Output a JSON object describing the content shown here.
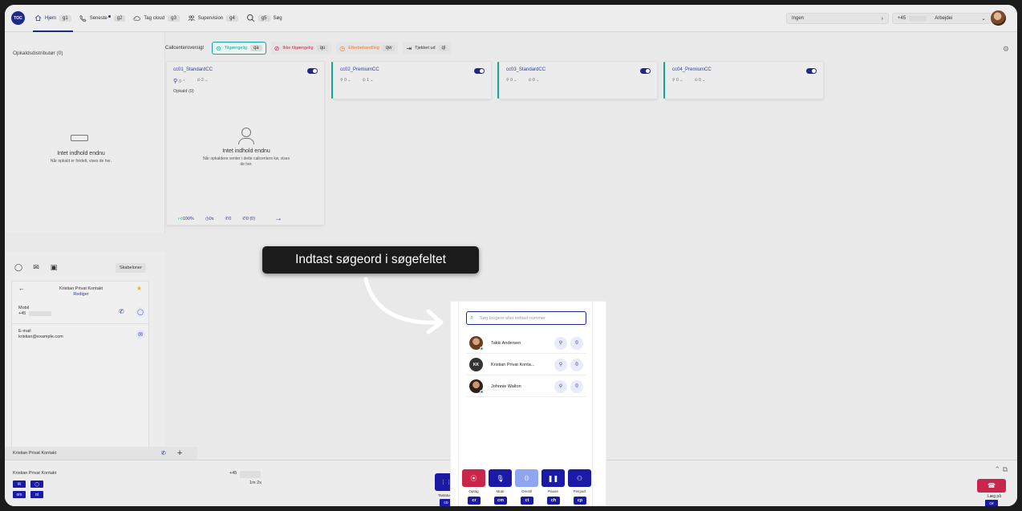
{
  "nav": {
    "logo": "TOC",
    "items": [
      {
        "label": "Hjem",
        "key": "g1"
      },
      {
        "label": "Seneste",
        "key": "g2"
      },
      {
        "label": "Tag cloud",
        "key": "g3"
      },
      {
        "label": "Supervision",
        "key": "g4"
      },
      {
        "label": "Søg",
        "key": "g5"
      }
    ],
    "queue_select": "Ingen",
    "phone_prefix": "+45",
    "status_select": "Arbejdei"
  },
  "left_panel": {
    "title": "Opkaldsdistributør (0)",
    "empty_title": "Intet indhold endnu",
    "empty_sub": "Når opkald er fordelt, vises de her."
  },
  "statusbar": {
    "label": "Callcenteroversigt",
    "available": {
      "label": "Tilgængelig",
      "key": "qa"
    },
    "unavailable": {
      "label": "Ikke tilgængelig",
      "key": "qu"
    },
    "wrapup": {
      "label": "Efterbehandling",
      "key": "qw"
    },
    "checkedout": {
      "label": "Tjekket ud",
      "key": "ql"
    }
  },
  "cards": [
    {
      "name": "cc01_StandardCC",
      "agents": "0",
      "waiting": "2",
      "calls_label": "Opkald (0)"
    },
    {
      "name": "cc02_PremiumCC",
      "agents": "0",
      "waiting": "1"
    },
    {
      "name": "cc03_StandardCC",
      "agents": "0",
      "waiting": "0"
    },
    {
      "name": "cc04_PremiumCC",
      "agents": "0",
      "waiting": "0"
    }
  ],
  "card1": {
    "empty_title": "Intet indhold endnu",
    "empty_sub": "Når opkaldere venter i dette callcenters kø, vises de her.",
    "footer": {
      "rate": "100%",
      "time": "0s",
      "calls": "0",
      "missed": "0 (0)"
    }
  },
  "chat_panel": {
    "templates_button": "Skabeloner",
    "contact_name": "Kristian Privat Kontakt",
    "edit_link": "Rediger",
    "mobile_label": "Mobil",
    "mobile_value": "+45",
    "email_label": "E-mail",
    "email_value": "kristian@example.com",
    "tab_label": "Kristian Privat Kontakt"
  },
  "bottom": {
    "caller": "Kristian Privat Kontakt",
    "number": "+45",
    "duration": "1m 2s",
    "keys": [
      "om",
      "ot"
    ],
    "hangup_label": "Læg på",
    "hangup_key": "ce",
    "keypad_label": "Tastatur",
    "keypad_key": "co"
  },
  "tooltip": "Indtast søgeord i søgefeltet",
  "popup": {
    "search_placeholder": "Søg brugere eller indtast nummer",
    "results": [
      {
        "name": "Takki Andersen"
      },
      {
        "name": "Kristian Privat Konta...",
        "initials": "KK"
      },
      {
        "name": "Johnnie Walton"
      }
    ]
  },
  "controls": [
    {
      "label": "Optag",
      "key": "cr"
    },
    {
      "label": "Mute",
      "key": "cm"
    },
    {
      "label": "Omstil",
      "key": "ct"
    },
    {
      "label": "Pause",
      "key": "ch"
    },
    {
      "label": "Flerpart",
      "key": "cp"
    }
  ],
  "colors": {
    "brand": "#1e2a8a",
    "accent": "#15a59a",
    "danger": "#c8264a",
    "warn": "#e07b3a"
  }
}
